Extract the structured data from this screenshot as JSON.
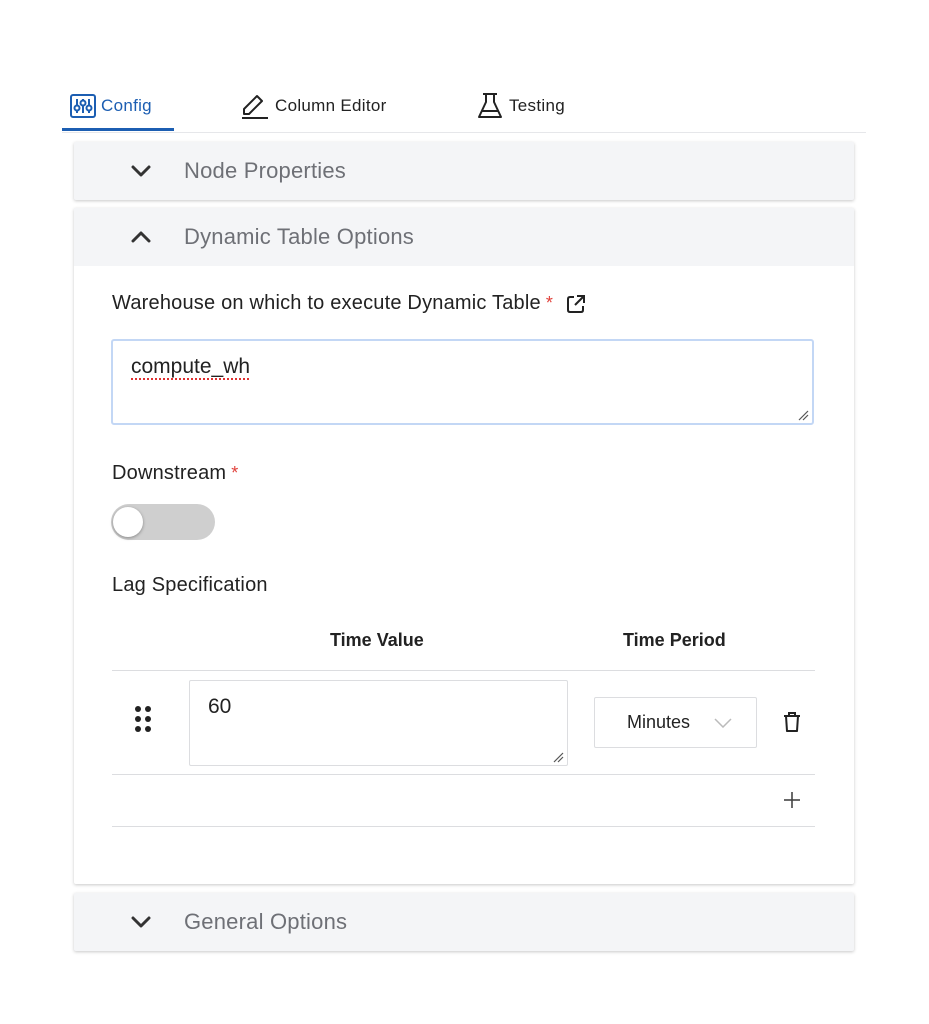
{
  "tabs": {
    "config_label": "Config",
    "column_editor_label": "Column Editor",
    "testing_label": "Testing"
  },
  "panels": {
    "node_properties_title": "Node Properties",
    "dynamic_table_title": "Dynamic Table Options",
    "general_options_title": "General Options"
  },
  "dynamic_table": {
    "warehouse_label": "Warehouse on which to execute Dynamic Table",
    "warehouse_value": "compute_wh",
    "downstream_label": "Downstream",
    "downstream_enabled": false,
    "lag_label": "Lag Specification",
    "lag_table": {
      "headers": [
        "Time Value",
        "Time Period"
      ],
      "rows": [
        {
          "time_value": "60",
          "time_period": "Minutes"
        }
      ]
    },
    "required_marker": "*"
  },
  "colors": {
    "accent": "#1c5eb2",
    "required": "#e0403a",
    "panel_bg": "#f4f5f7"
  },
  "icons": {
    "config": "sliders-icon",
    "column_editor": "pencil-icon",
    "testing": "flask-icon",
    "external_link": "external-link-icon",
    "drag": "drag-handle-icon",
    "delete": "trash-icon",
    "add": "plus-icon"
  }
}
